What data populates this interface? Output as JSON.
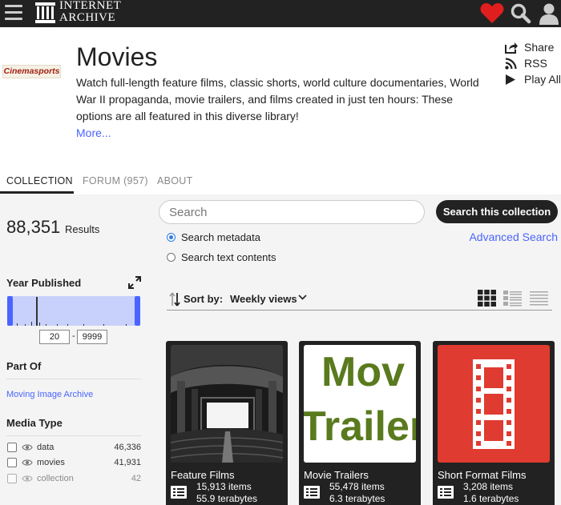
{
  "nav": {
    "logo_line1": "INTERNET",
    "logo_line2": "ARCHIVE"
  },
  "header": {
    "collection_logo_text": "Cinemasports",
    "title": "Movies",
    "description": "Watch full-length feature films, classic shorts, world culture documentaries, World War II propaganda, movie trailers, and films created in just ten hours: These options are all featured in this diverse library!",
    "more_label": "More...",
    "actions": {
      "share": "Share",
      "rss": "RSS",
      "play_all": "Play All"
    }
  },
  "tabs": {
    "collection": "COLLECTION",
    "forum": "FORUM (957)",
    "about": "ABOUT"
  },
  "sidebar": {
    "results_count": "88,351",
    "results_label": "Results",
    "year_facet": {
      "title": "Year Published",
      "from": "20",
      "separator": "-",
      "to": "9999"
    },
    "part_of": {
      "title": "Part Of",
      "link": "Moving Image Archive"
    },
    "media_type": {
      "title": "Media Type",
      "items": [
        {
          "label": "data",
          "count": "46,336"
        },
        {
          "label": "movies",
          "count": "41,931"
        },
        {
          "label": "collection",
          "count": "42"
        }
      ]
    }
  },
  "search": {
    "placeholder": "Search",
    "button_label": "Search this collection",
    "option_metadata": "Search metadata",
    "option_text": "Search text contents",
    "advanced_label": "Advanced Search"
  },
  "sort": {
    "label": "Sort by:",
    "value": "Weekly views"
  },
  "cards": [
    {
      "title": "Feature Films",
      "items": "15,913 items",
      "size": "55.9 terabytes"
    },
    {
      "title": "Movie Trailers",
      "items": "55,478 items",
      "size": "6.3 terabytes",
      "thumb_line1": "Mov",
      "thumb_line2": "Trailer"
    },
    {
      "title": "Short Format Films",
      "items": "3,208 items",
      "size": "1.6 terabytes"
    }
  ],
  "colors": {
    "nav_bg": "#222222",
    "link": "#4b64ff",
    "heart": "#e11e1e",
    "short_films_thumb": "#df3b31",
    "trailers_text": "#5a7a1e"
  },
  "icons": [
    "hamburger-menu-icon",
    "temple-logo-icon",
    "heart-icon",
    "search-icon",
    "user-icon",
    "share-icon",
    "rss-icon",
    "play-icon",
    "expand-icon",
    "eye-icon",
    "sort-icon",
    "chevron-down-icon",
    "grid-view-icon",
    "list-view-icon",
    "compact-view-icon",
    "collection-list-icon",
    "film-strip-icon"
  ]
}
